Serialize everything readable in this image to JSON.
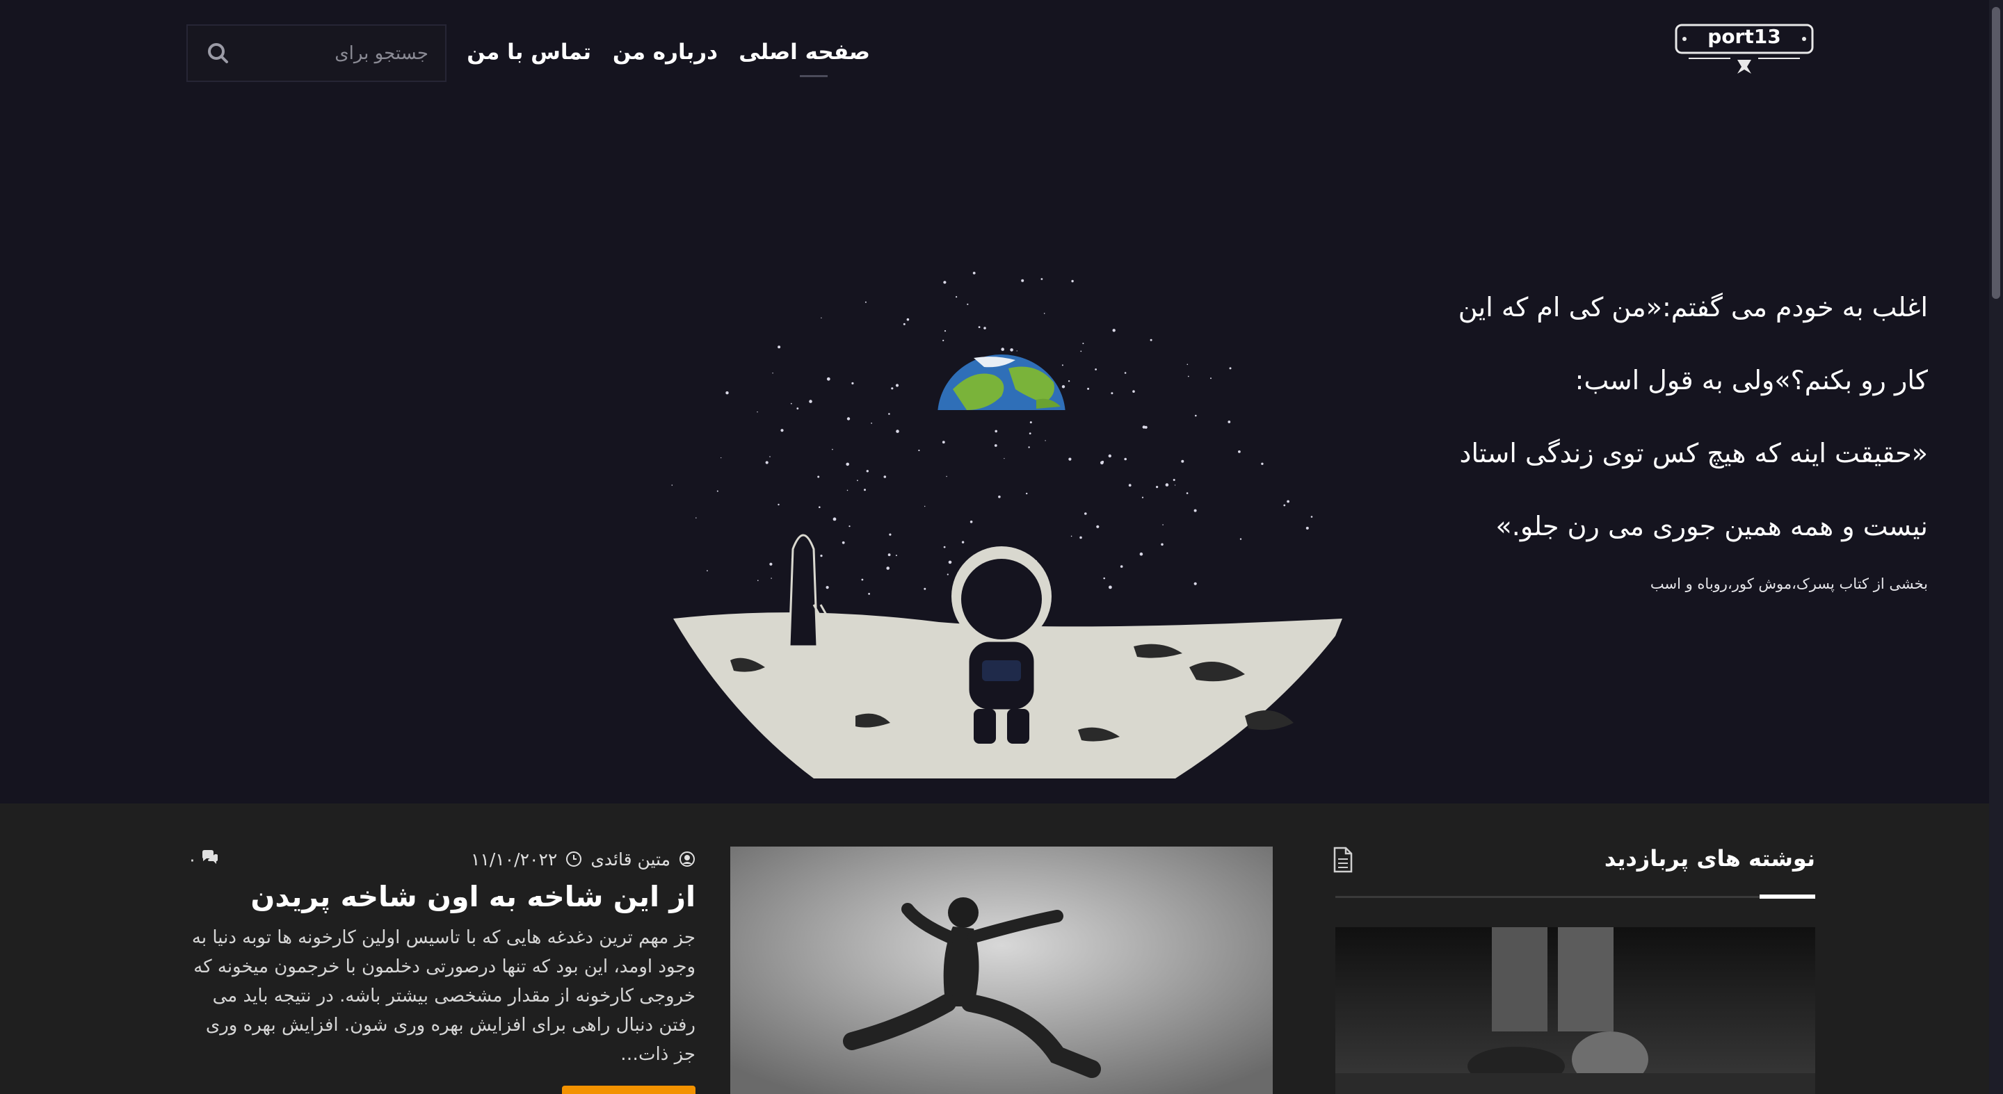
{
  "header": {
    "logo_text": "port13",
    "nav": {
      "home": "صفحه اصلی",
      "about": "درباره من",
      "contact": "تماس با من"
    },
    "search": {
      "placeholder": "جستجو برای"
    },
    "icons": {
      "search": "search-icon"
    }
  },
  "hero": {
    "quote_lines": [
      "اغلب به خودم می گفتم:«من کی ام که این",
      "کار رو بکنم؟»ولی به قول اسب:",
      "«حقیقت اینه که هیچ کس توی زندگی استاد",
      "نیست و همه همین جوری می رن جلو.»"
    ],
    "source": "بخشی از کتاب پسرک،موش کور،روباه و اسب"
  },
  "sidebar": {
    "title": "نوشته های پربازدید",
    "icon": "document-icon"
  },
  "post": {
    "author": "متین قائدی",
    "date": "۱۱/۱۰/۲۰۲۲",
    "comments": "۰",
    "title": "از این شاخه به اون شاخه پریدن",
    "excerpt": "جز مهم ترین دغدغه هایی که با تاسیس اولین کارخونه ها توبه دنیا به وجود اومد، این بود که تنها درصورتی دخلمون با خرجمون میخونه که خروجی کارخونه از مقدار مشخصی بیشتر باشه. در نتیجه باید می رفتن دنبال راهی برای افزایش بهره وری شون. افزایش بهره وری جز ذات…"
  },
  "colors": {
    "background": "#15141f",
    "section": "#1f1f1f",
    "accent": "#f39200",
    "text": "#ffffff"
  }
}
